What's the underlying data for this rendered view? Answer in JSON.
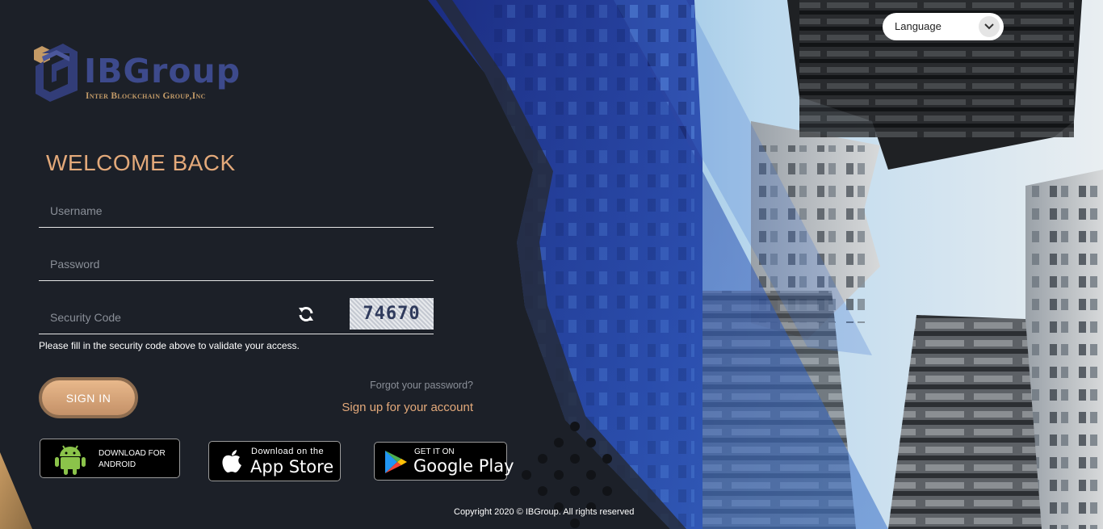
{
  "brand": {
    "name": "IBGroup",
    "subtitle": "Inter Blockchain Group,Inc"
  },
  "language": {
    "label": "Language"
  },
  "login": {
    "welcome": "WELCOME BACK",
    "username_placeholder": "Username",
    "password_placeholder": "Password",
    "security_placeholder": "Security Code",
    "captcha_code": "74670",
    "hint": "Please fill in the security code above to validate your access.",
    "signin_label": "SIGN IN",
    "forgot_label": "Forgot your password?",
    "signup_label": "Sign up for your account"
  },
  "stores": {
    "android_line1": "DOWNLOAD FOR",
    "android_line2": "ANDROID",
    "appstore_small": "Download on the",
    "appstore_big": "App Store",
    "googleplay_small": "GET IT ON",
    "googleplay_big": "Google Play"
  },
  "footer": {
    "copyright": "Copyright 2020 © IBGroup. All rights reserved"
  },
  "colors": {
    "accent": "#e3a97a",
    "brand_blue": "#3d4a8c",
    "panel_bg": "#1c2028"
  },
  "icons": {
    "refresh": "refresh-icon",
    "android": "android-icon",
    "apple": "apple-icon",
    "google_play": "google-play-icon",
    "chevron": "chevron-down-icon"
  }
}
